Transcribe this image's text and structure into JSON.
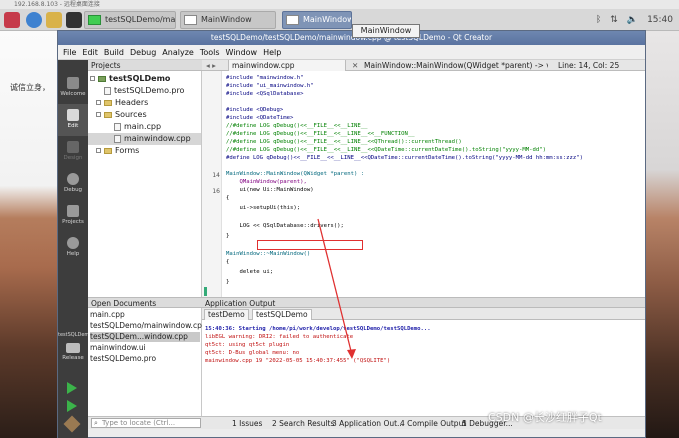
{
  "remote_bar": {
    "text": "192.168.8.103 - 远程桌面连接"
  },
  "taskbar": {
    "buttons": [
      {
        "label": "testSQLDemo/mainw..."
      },
      {
        "label": "MainWindow"
      },
      {
        "label": "MainWindow"
      }
    ],
    "clock": "15:40"
  },
  "tooltip": "MainWindow",
  "desktop_side_text": "诚信立身，",
  "window": {
    "title": "testSQLDemo/testSQLDemo/mainwindow.cpp @ testSQLDemo - Qt Creator",
    "menu": [
      "File",
      "Edit",
      "Build",
      "Debug",
      "Analyze",
      "Tools",
      "Window",
      "Help"
    ]
  },
  "modes": [
    {
      "label": "Welcome"
    },
    {
      "label": "Edit"
    },
    {
      "label": "Design"
    },
    {
      "label": "Debug"
    },
    {
      "label": "Projects"
    },
    {
      "label": "Help"
    }
  ],
  "kit": {
    "project": "testSQLDemo",
    "label": "Release"
  },
  "projects": {
    "header": "Projects",
    "items": [
      {
        "label": "testSQLDemo"
      },
      {
        "label": "testSQLDemo.pro"
      },
      {
        "label": "Headers"
      },
      {
        "label": "Sources"
      },
      {
        "label": "main.cpp"
      },
      {
        "label": "mainwindow.cpp"
      },
      {
        "label": "Forms"
      }
    ]
  },
  "editor": {
    "file_tab": "mainwindow.cpp",
    "symbol": "MainWindow::MainWindow(QWidget *parent) -> void",
    "position": "Line: 14, Col: 25",
    "lines": [
      "#include \"mainwindow.h\"",
      "#include \"ui_mainwindow.h\"",
      "#include <QSqlDatabase>",
      "",
      "#include <QDebug>",
      "#include <QDateTime>",
      "//#define LOG qDebug()<<__FILE__<<__LINE__",
      "//#define LOG qDebug()<<__FILE__<<__LINE__<<__FUNCTION__",
      "//#define LOG qDebug()<<__FILE__<<__LINE__<<QThread()::currentThread()",
      "//#define LOG qDebug()<<__FILE__<<__LINE__<<QDateTime::currentDateTime().toString(\"yyyy-MM-dd\")",
      "#define LOG qDebug()<<__FILE__<<__LINE__<<QDateTime::currentDateTime().toString(\"yyyy-MM-dd hh:mm:ss:zzz\")",
      "",
      "MainWindow::MainWindow(QWidget *parent) :",
      "    QMainWindow(parent),",
      "    ui(new Ui::MainWindow)",
      "{",
      "    ui->setupUi(this);",
      "",
      "    LOG << QSqlDatabase::drivers();",
      "}",
      "",
      "MainWindow::~MainWindow()",
      "{",
      "    delete ui;",
      "}"
    ],
    "line_numbers": [
      "14",
      "16"
    ]
  },
  "open_documents": {
    "header": "Open Documents",
    "items": [
      {
        "label": "main.cpp"
      },
      {
        "label": "testSQLDemo/mainwindow.cpp"
      },
      {
        "label": "testSQLDem...window.cpp"
      },
      {
        "label": "mainwindow.ui"
      },
      {
        "label": "testSQLDemo.pro"
      }
    ]
  },
  "output": {
    "header": "Application Output",
    "tab": "testDemo",
    "tab_active": "testSQLDemo",
    "lines": [
      "15:40:36: Starting /home/pi/work/develop/testSQLDemo/testSQLDemo...",
      "libEGL warning: DRI2: failed to authenticate",
      "qt5ct: using qt5ct plugin",
      "qt5ct: D-Bus global menu: no",
      "mainwindow.cpp 19 \"2022-05-05 15:40:37:455\" (\"QSQLITE\")"
    ]
  },
  "statusbar": {
    "locator_placeholder": "Type to locate (Ctrl...",
    "items": [
      "1 Issues",
      "2 Search Results",
      "3 Application Out...",
      "4 Compile Output",
      "5 Debugger..."
    ]
  },
  "watermark": "CSDN @长沙红胖子Qt"
}
